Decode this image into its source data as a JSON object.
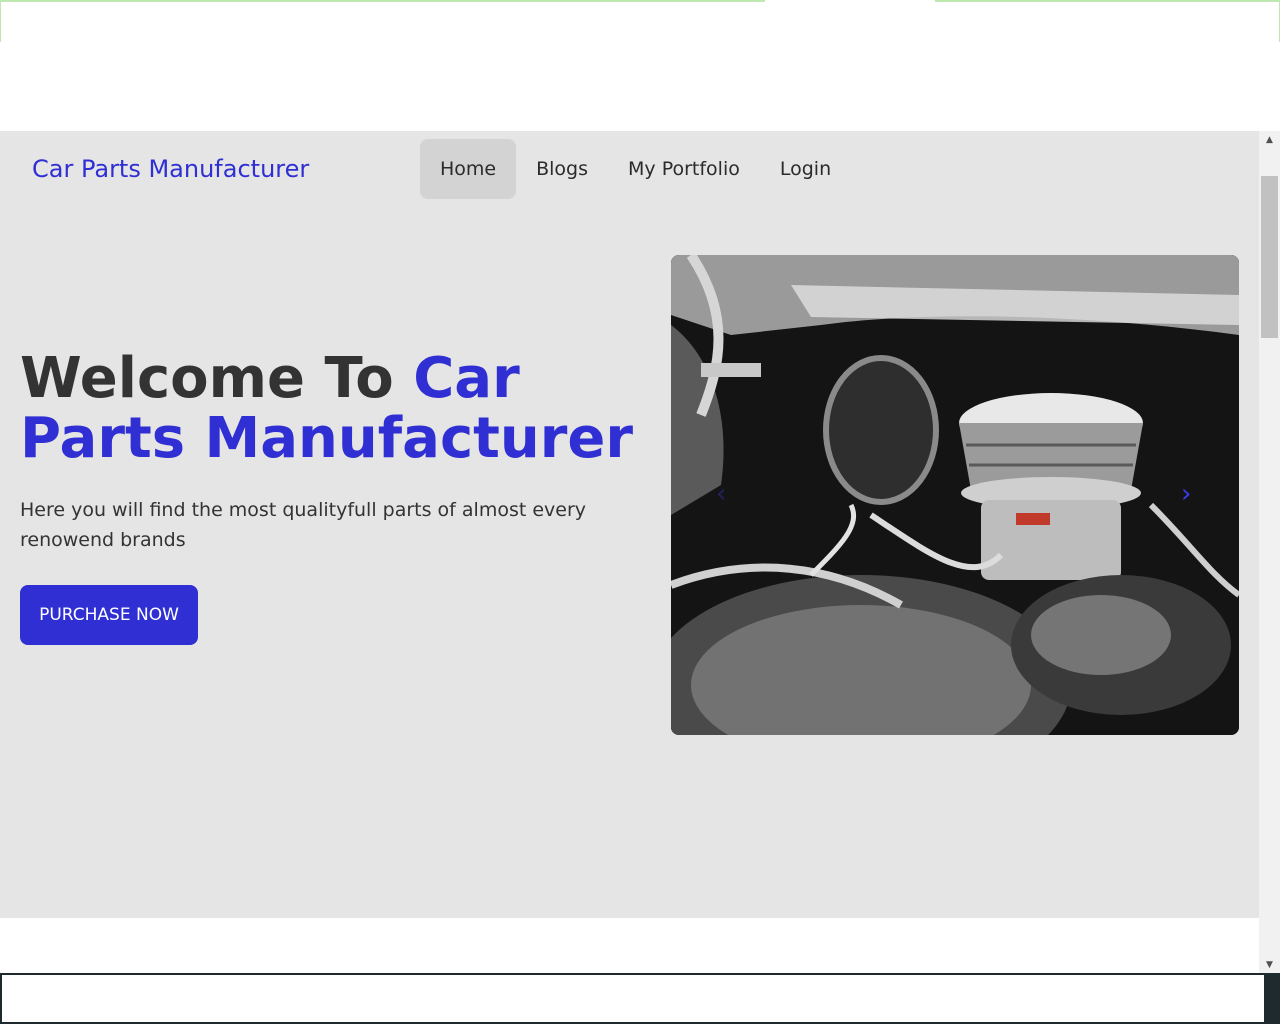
{
  "navbar": {
    "brand": "Car Parts Manufacturer",
    "items": [
      {
        "label": "Home",
        "active": true
      },
      {
        "label": "Blogs",
        "active": false
      },
      {
        "label": "My Portfolio",
        "active": false
      },
      {
        "label": "Login",
        "active": false
      }
    ]
  },
  "hero": {
    "title_prefix": "Welcome To ",
    "title_accent": "Car Parts Manufacturer",
    "subtitle": "Here you will find the most qualityfull parts of almost every renowend brands",
    "cta_label": "PURCHASE NOW"
  },
  "carousel": {
    "prev_icon": "‹",
    "next_icon": "›",
    "image": "chrome-engine-photo"
  },
  "scrollbar": {
    "up_icon": "▲",
    "down_icon": "▼"
  },
  "colors": {
    "accent": "#2f2fd4",
    "hero_bg": "#e5e5e5",
    "text": "#333333"
  }
}
